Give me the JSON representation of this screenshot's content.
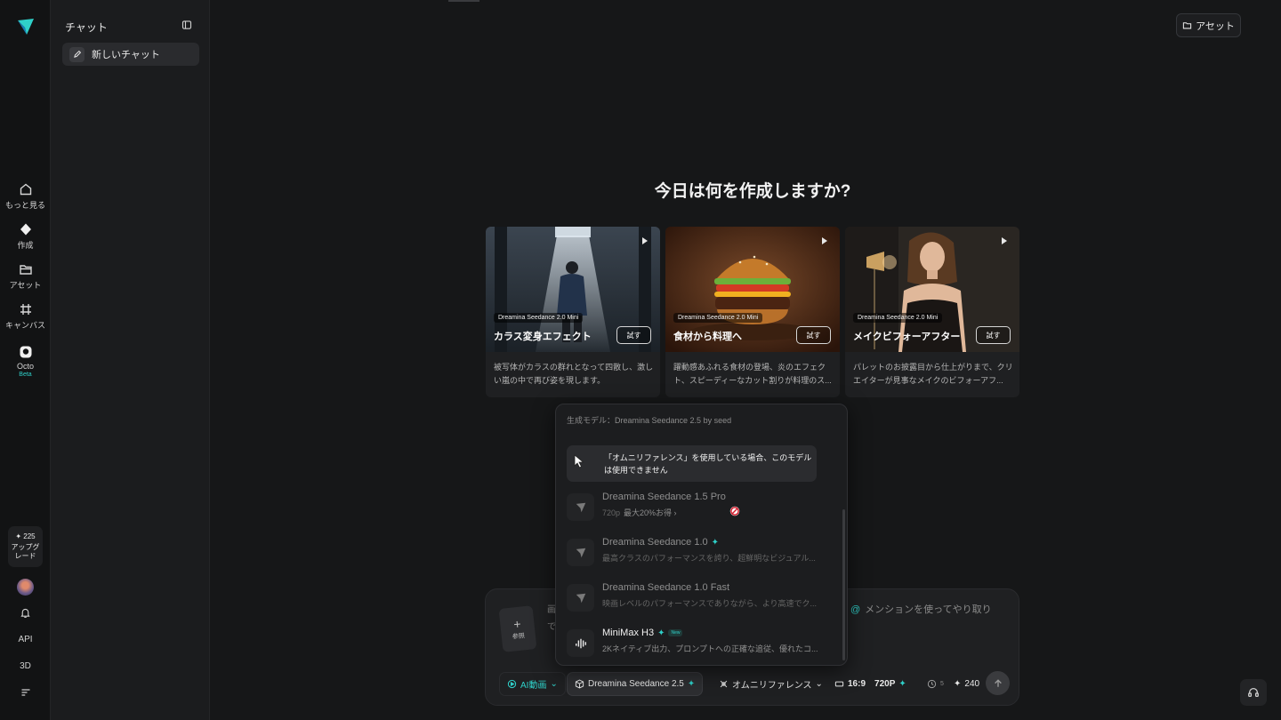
{
  "rail": {
    "items": [
      {
        "label": "もっと見る",
        "icon": "home-icon"
      },
      {
        "label": "作成",
        "icon": "diamond-icon"
      },
      {
        "label": "アセット",
        "icon": "folder-icon"
      },
      {
        "label": "キャンバス",
        "icon": "canvas-icon"
      },
      {
        "label": "Octo",
        "icon": "octo-icon",
        "badge": "Beta"
      }
    ],
    "credits": "225",
    "upgrade_label": "アップグレード",
    "api_label": "API",
    "threed_label": "3D"
  },
  "sidebar": {
    "title": "チャット",
    "new_chat": "新しいチャット"
  },
  "header": {
    "assets_button": "アセット"
  },
  "main": {
    "heading": "今日は何を作成しますか?",
    "cards": [
      {
        "model": "Dreamina Seedance 2.0 Mini",
        "title": "カラス変身エフェクト",
        "try": "試す",
        "desc": "被写体がカラスの群れとなって四散し、激しい嵐の中で再び姿を現します。"
      },
      {
        "model": "Dreamina Seedance 2.0 Mini",
        "title": "食材から料理へ",
        "try": "試す",
        "desc": "躍動感あふれる食材の登場、炎のエフェクト、スピーディーなカット割りが料理のス..."
      },
      {
        "model": "Dreamina Seedance 2.0 Mini",
        "title": "メイクビフォーアフター",
        "try": "試す",
        "desc": "パレットのお披露目から仕上がりまで、クリエイターが見事なメイクのビフォーアフ..."
      }
    ]
  },
  "dropdown": {
    "header": "生成モデル：Dreamina Seedance 2.5 by seed",
    "warning": "「オムニリファレンス」を使用している場合、このモデルは使用できません",
    "items": [
      {
        "name": "Dreamina Seedance 1.5 Pro",
        "sub": "720p",
        "offer": "最大20%お得 ›",
        "active": false
      },
      {
        "name": "Dreamina Seedance 1.0",
        "sub": "最高クラスのパフォーマンスを誇り、超鮮明なビジュアル...",
        "active": false
      },
      {
        "name": "Dreamina Seedance 1.0 Fast",
        "sub": "映画レベルのパフォーマンスでありながら、より高速でク...",
        "active": false
      },
      {
        "name": "MiniMax H3",
        "sub": "2Kネイティブ出力、プロンプトへの正確な追従、優れたコ...",
        "new": "New",
        "active": true
      }
    ]
  },
  "composer": {
    "ref_label": "参照",
    "hint_left_1": "画",
    "hint_left_2": "で",
    "hint_right": "メンションを使ってやり取り",
    "mode": "AI動画",
    "model": "Dreamina Seedance 2.5",
    "reference": "オムニリファレンス",
    "ratio": "16:9",
    "resolution": "720P",
    "duration": "5",
    "credit_cost": "240"
  },
  "colors": {
    "accent": "#2fd0c9",
    "bg": "#161718"
  }
}
